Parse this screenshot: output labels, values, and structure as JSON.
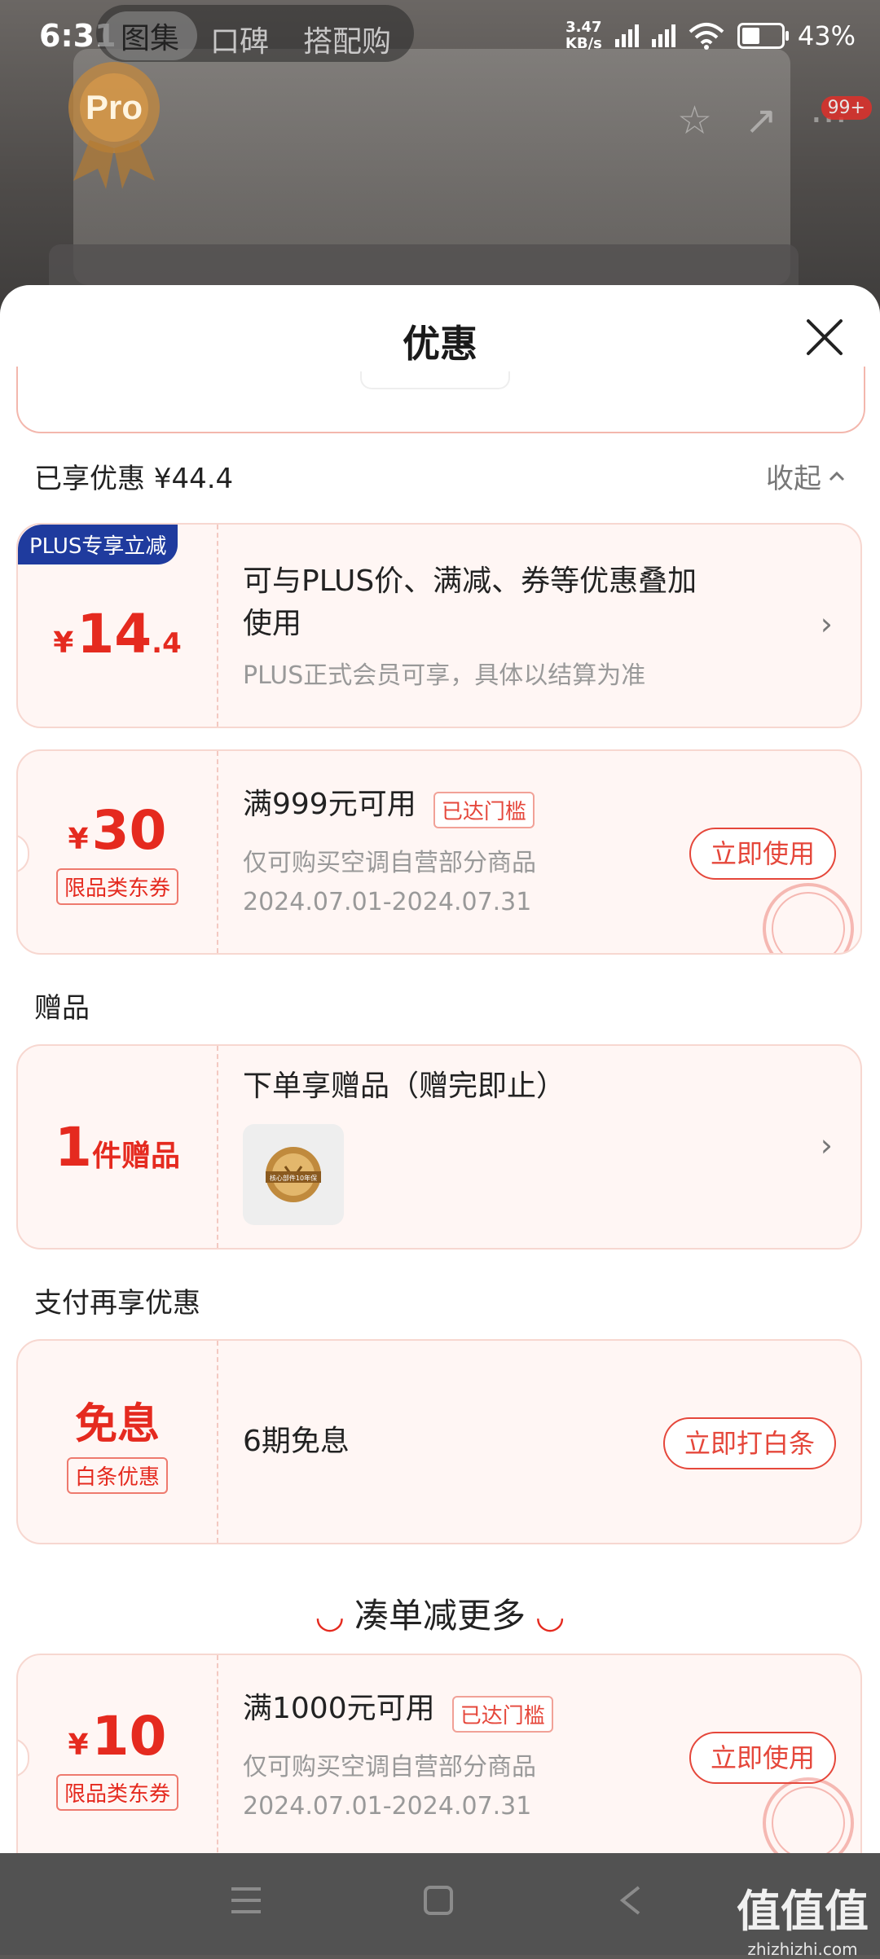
{
  "status_bar": {
    "time": "6:31",
    "net_speed": "3.47",
    "net_unit": "KB/s",
    "battery": "43%"
  },
  "bg_tabs": [
    "图集",
    "口碑",
    "搭配购"
  ],
  "bg_count_badge": "99+",
  "bg_badge_text": "Pro",
  "sheet": {
    "title": "优惠",
    "enjoyed_label": "已享优惠 ¥44.4",
    "collapse_label": "收起",
    "plus_card": {
      "badge": "PLUS专享立减",
      "currency": "¥",
      "amount_int": "14",
      "amount_dec": ".4",
      "desc": "可与PLUS价、满减、券等优惠叠加使用",
      "note": "PLUS正式会员可享，具体以结算为准"
    },
    "coupon_1": {
      "currency": "¥",
      "amount": "30",
      "type": "限品类东券",
      "condition": "满999元可用",
      "reached": "已达门槛",
      "scope": "仅可购买空调自营部分商品",
      "dates": "2024.07.01-2024.07.31",
      "button": "立即使用"
    },
    "gift_section": "赠品",
    "gift_card": {
      "count": "1",
      "unit": "件赠品",
      "desc": "下单享赠品（赠完即止）",
      "image_icon": "gift-medal-icon",
      "image_caption": "核心部件10年保"
    },
    "pay_section": "支付再享优惠",
    "pay_card": {
      "title": "免息",
      "tag": "白条优惠",
      "desc": "6期免息",
      "button": "立即打白条"
    },
    "more_banner": "凑单减更多",
    "coupon_2": {
      "currency": "¥",
      "amount": "10",
      "type": "限品类东券",
      "condition": "满1000元可用",
      "reached": "已达门槛",
      "scope": "仅可购买空调自营部分商品",
      "dates": "2024.07.01-2024.07.31",
      "button": "立即使用"
    }
  },
  "watermark": {
    "main": "值值值",
    "sub": "zhizhizhi.com"
  },
  "colors": {
    "accent": "#e52a1f",
    "plus_badge": "#1f3b9e",
    "card_bg": "#fff6f4"
  }
}
